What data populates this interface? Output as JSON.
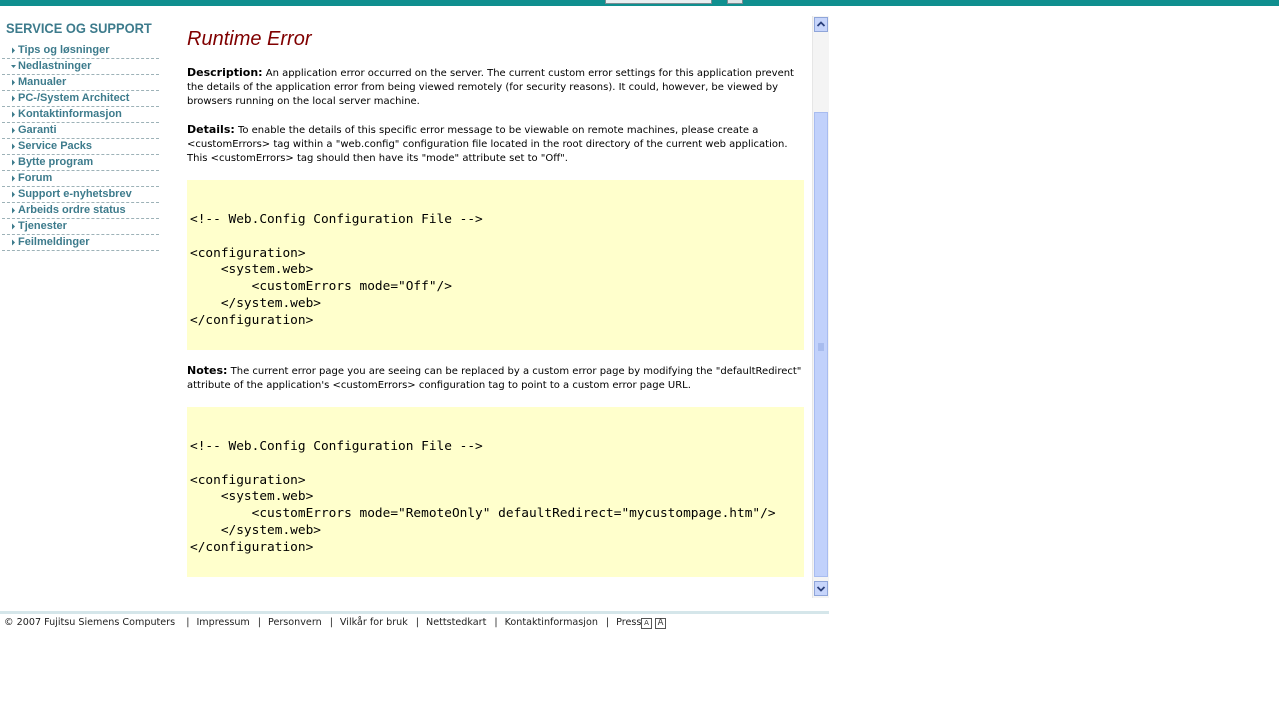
{
  "sidebar": {
    "title": "SERVICE OG SUPPORT",
    "items": [
      {
        "label": "Tips og løsninger",
        "expanded": false
      },
      {
        "label": "Nedlastninger",
        "expanded": true
      },
      {
        "label": "Manualer",
        "expanded": false
      },
      {
        "label": "PC-/System Architect",
        "expanded": false
      },
      {
        "label": "Kontaktinformasjon",
        "expanded": false
      },
      {
        "label": "Garanti",
        "expanded": false
      },
      {
        "label": "Service Packs",
        "expanded": false
      },
      {
        "label": "Bytte program",
        "expanded": false
      },
      {
        "label": "Forum",
        "expanded": false
      },
      {
        "label": "Support e-nyhetsbrev",
        "expanded": false
      },
      {
        "label": "Arbeids ordre status",
        "expanded": false
      },
      {
        "label": "Tjenester",
        "expanded": false
      },
      {
        "label": "Feilmeldinger",
        "expanded": false
      }
    ]
  },
  "main": {
    "heading": "Runtime Error",
    "description_label": "Description:",
    "description_text": " An application error occurred on the server. The current custom error settings for this application prevent the details of the application error from being viewed remotely (for security reasons). It could, however, be viewed by browsers running on the local server machine.",
    "details_label": "Details:",
    "details_text": " To enable the details of this specific error message to be viewable on remote machines, please create a <customErrors> tag within a \"web.config\" configuration file located in the root directory of the current web application. This <customErrors> tag should then have its \"mode\" attribute set to \"Off\".",
    "code1": [
      "<!-- Web.Config Configuration File -->",
      "",
      "<configuration>",
      "    <system.web>",
      "        <customErrors mode=\"Off\"/>",
      "    </system.web>",
      "</configuration>"
    ],
    "notes_label": "Notes:",
    "notes_text": " The current error page you are seeing can be replaced by a custom error page by modifying the \"defaultRedirect\" attribute of the application's <customErrors> configuration tag to point to a custom error page URL.",
    "code2": [
      "<!-- Web.Config Configuration File -->",
      "",
      "<configuration>",
      "    <system.web>",
      "        <customErrors mode=\"RemoteOnly\" defaultRedirect=\"mycustompage.htm\"/>",
      "    </system.web>",
      "</configuration>"
    ]
  },
  "footer": {
    "copyright": "© 2007 Fujitsu Siemens Computers",
    "links": [
      "Impressum",
      "Personvern",
      "Vilkår for bruk",
      "Nettstedkart",
      "Kontaktinformasjon",
      "Presse"
    ],
    "font_small": "A",
    "font_large": "A"
  },
  "colors": {
    "topbar": "#0f8f8f",
    "nav_text": "#3d7b8c",
    "heading": "#800000",
    "code_bg": "#ffffcc",
    "scrollbar_thumb": "#c1d1fb"
  }
}
